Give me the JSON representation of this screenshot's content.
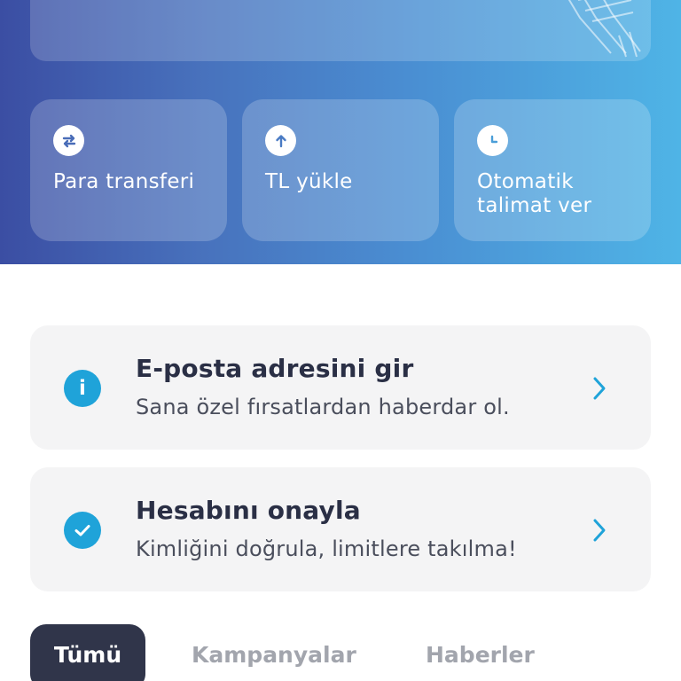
{
  "colors": {
    "accent": "#1fa3d9",
    "hero_start": "#3b4ea3",
    "hero_end": "#4fb4e6",
    "card_bg": "#f4f4f5",
    "dark": "#30354a"
  },
  "quick_actions": [
    {
      "label": "Para transferi",
      "icon": "transfer-arrows-icon"
    },
    {
      "label": "TL yükle",
      "icon": "arrow-up-icon"
    },
    {
      "label": "Otomatik talimat ver",
      "icon": "clock-icon"
    }
  ],
  "cards": [
    {
      "title": "E-posta adresini gir",
      "subtitle": "Sana özel fırsatlardan haberdar ol.",
      "icon": "info-icon"
    },
    {
      "title": "Hesabını onayla",
      "subtitle": "Kimliğini doğrula, limitlere takılma!",
      "icon": "check-icon"
    }
  ],
  "tabs": [
    {
      "label": "Tümü",
      "active": true
    },
    {
      "label": "Kampanyalar",
      "active": false
    },
    {
      "label": "Haberler",
      "active": false
    }
  ]
}
